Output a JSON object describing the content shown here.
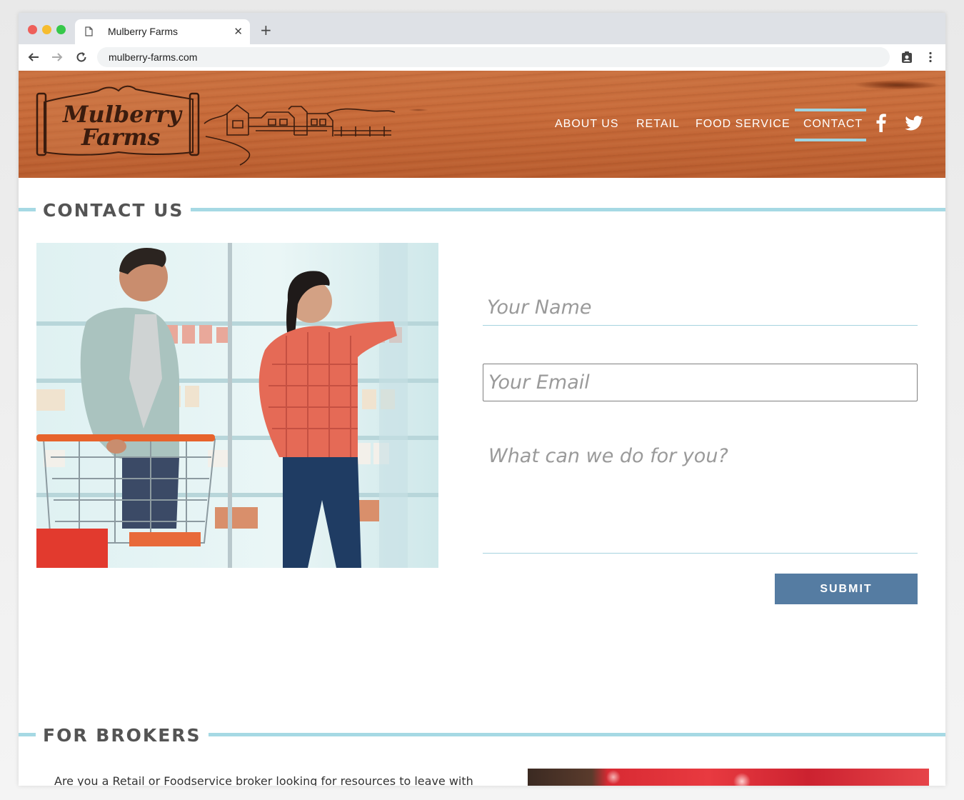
{
  "browser": {
    "tab_title": "Mulberry Farms",
    "url": "mulberry-farms.com"
  },
  "logo": {
    "line1": "Mulberry",
    "line2": "Farms"
  },
  "nav": {
    "items": [
      {
        "label": "ABOUT US"
      },
      {
        "label": "RETAIL"
      },
      {
        "label": "FOOD SERVICE"
      },
      {
        "label": "CONTACT",
        "active": true
      }
    ],
    "social": [
      "facebook-icon",
      "twitter-icon"
    ]
  },
  "contact": {
    "title": "CONTACT US",
    "name_placeholder": "Your Name",
    "email_placeholder": "Your Email",
    "message_placeholder": "What can we do for you?",
    "submit_label": "SUBMIT"
  },
  "brokers": {
    "title": "FOR BROKERS",
    "text": "Are you a Retail or Foodservice broker looking for resources to leave with"
  },
  "colors": {
    "accent_line": "#a6d9e4",
    "submit_bg": "#557ca2",
    "heading": "#545454",
    "wood": "#c76a39"
  }
}
